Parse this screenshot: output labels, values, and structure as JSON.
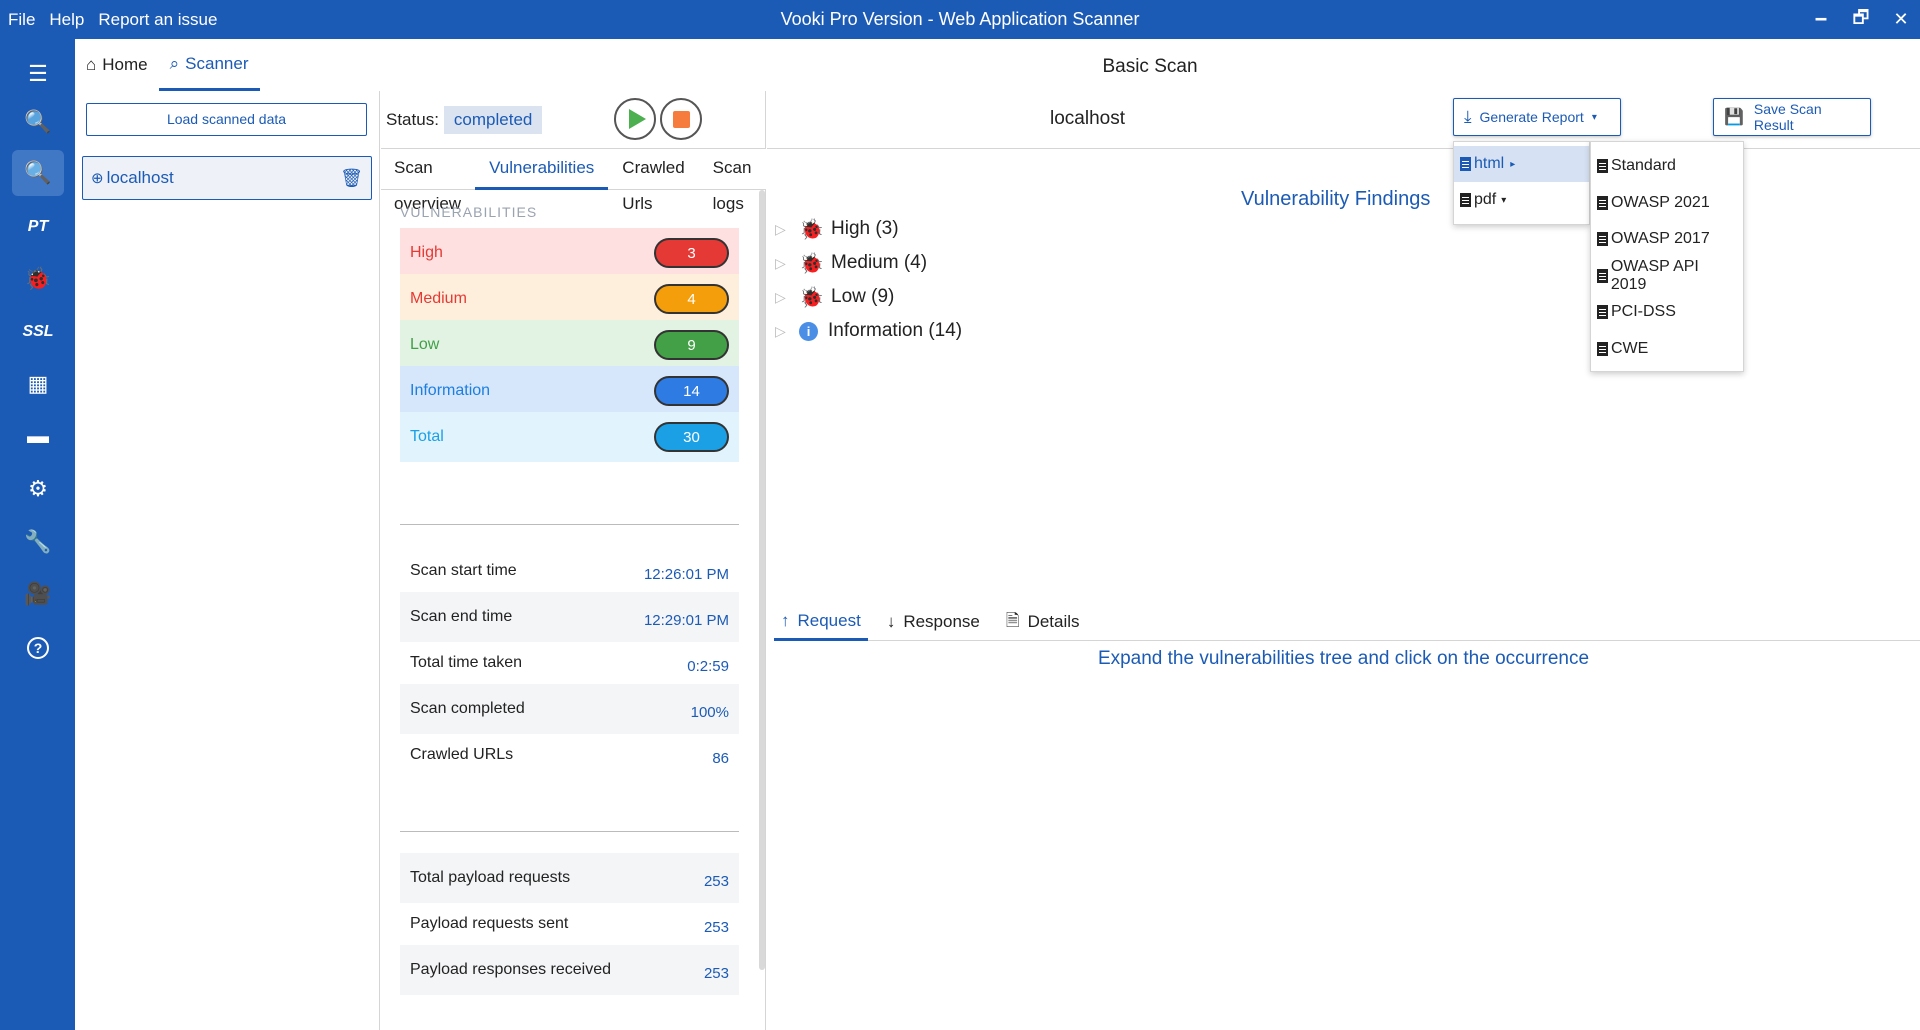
{
  "window": {
    "title": "Vooki Pro Version - Web Application Scanner",
    "menus": [
      "File",
      "Help",
      "Report an issue"
    ],
    "controls": {
      "minimize": "🗕",
      "restore": "🗗",
      "close": "✕"
    }
  },
  "rail": {
    "items": [
      {
        "name": "menu-icon",
        "glyph": "☰"
      },
      {
        "name": "zoom-search-icon",
        "glyph": "🔍"
      },
      {
        "name": "search-icon",
        "glyph": "🔍",
        "active": true
      },
      {
        "name": "pt-label",
        "glyph": "PT"
      },
      {
        "name": "bug-icon",
        "glyph": "🐞"
      },
      {
        "name": "ssl-label",
        "glyph": "SSL"
      },
      {
        "name": "network-icon",
        "glyph": "▦"
      },
      {
        "name": "card-icon",
        "glyph": "▬"
      },
      {
        "name": "gears-icon",
        "glyph": "⚙"
      },
      {
        "name": "wrench-icon",
        "glyph": "🔧"
      },
      {
        "name": "video-icon",
        "glyph": "🎥"
      },
      {
        "name": "help-icon",
        "glyph": "?"
      }
    ]
  },
  "nav": {
    "home": "Home",
    "scanner": "Scanner"
  },
  "page_title": "Basic Scan",
  "left": {
    "load_button": "Load scanned data",
    "host": "localhost"
  },
  "status": {
    "label": "Status:",
    "value": "completed"
  },
  "tabs": [
    "Scan overview",
    "Vulnerabilities",
    "Crawled Urls",
    "Scan logs"
  ],
  "vulns": {
    "header": "VULNERABILITIES",
    "rows": [
      {
        "label": "High",
        "count": "3",
        "bg": "#fde0df",
        "text": "#e53935",
        "pill": "#e53935"
      },
      {
        "label": "Medium",
        "count": "4",
        "bg": "#fdefdc",
        "text": "#e53935",
        "pill": "#f59e0b"
      },
      {
        "label": "Low",
        "count": "9",
        "bg": "#e2f3e4",
        "text": "#43a047",
        "pill": "#43a047"
      },
      {
        "label": "Information",
        "count": "14",
        "bg": "#d6e6fb",
        "text": "#1c7fe0",
        "pill": "#2d7be3"
      },
      {
        "label": "Total",
        "count": "30",
        "bg": "#e1f4fd",
        "text": "#1ba0e6",
        "pill": "#1ba0e6"
      }
    ]
  },
  "stats": [
    {
      "label": "Scan start time",
      "value": "12:26:01 PM"
    },
    {
      "label": "Scan end time",
      "value": "12:29:01 PM"
    },
    {
      "label": "Total time taken",
      "value": "0:2:59"
    },
    {
      "label": "Scan completed",
      "value": "100%"
    },
    {
      "label": "Crawled URLs",
      "value": "86"
    }
  ],
  "payload": [
    {
      "label": "Total payload requests",
      "value": "253"
    },
    {
      "label": "Payload requests sent",
      "value": "253"
    },
    {
      "label": "Payload responses received",
      "value": "253"
    }
  ],
  "right": {
    "host": "localhost",
    "generate_report": "Generate Report",
    "save_scan": "Save Scan Result",
    "findings_title": "Vulnerability Findings",
    "tree": [
      {
        "label": "High (3)",
        "color": "#e53935"
      },
      {
        "label": "Medium (4)",
        "color": "#f5b72b"
      },
      {
        "label": "Low (9)",
        "color": "#5bb974"
      },
      {
        "label": "Information (14)",
        "color": "#4a8ee6"
      }
    ],
    "req_tabs": [
      "Request",
      "Response",
      "Details"
    ],
    "hint": "Expand the vulnerabilities tree and click on the occurrence"
  },
  "dropdown": {
    "formats": [
      "html",
      "pdf"
    ],
    "report_types": [
      "Standard",
      "OWASP 2021",
      "OWASP 2017",
      "OWASP API 2019",
      "PCI-DSS",
      "CWE"
    ]
  }
}
